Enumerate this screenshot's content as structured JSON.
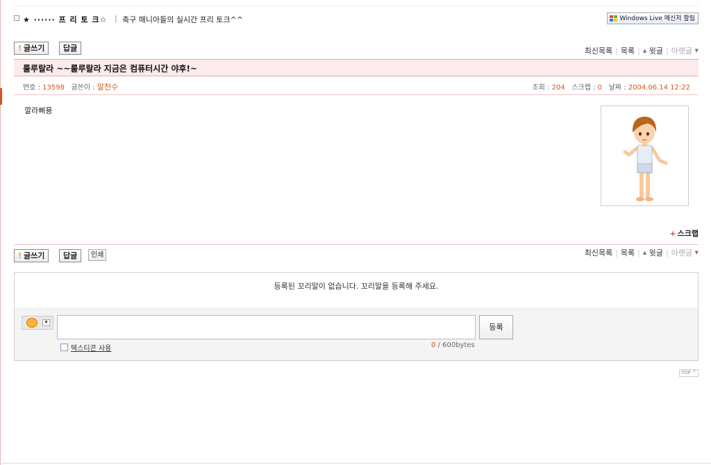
{
  "header": {
    "cafe_title": "★ ······ 프 리 토 크☆",
    "separator": "|",
    "cafe_desc": "축구 매니아들의 실시간 프리 토크^^",
    "windows_live_label": "Windows Live 메신저 할림"
  },
  "toolbar": {
    "write_label": "글쓰기",
    "reply_label": "답글",
    "print_label": "인쇄"
  },
  "nav": {
    "latest_label": "최신목록",
    "list_label": "목록",
    "prev_label": "윗글",
    "next_label": "아랫글"
  },
  "post": {
    "subject": "룰루랄라 ~~룰루랄라 지금은 컴퓨터시간 야후!~",
    "number_label": "번호 :",
    "number": "13598",
    "author_label": "글쓴이 :",
    "author": "말천수",
    "views_label": "조회 :",
    "views": "204",
    "scrap_label": "스크랩 :",
    "scrap_count": "0",
    "date_label": "날짜 :",
    "date": "2004.06.14 12:22",
    "body": "깔라삐용"
  },
  "scrap_button_label": "스크랩",
  "comments": {
    "empty_message": "등록된 꼬리말이 없습니다. 꼬리말을 등록해 주세요.",
    "submit_label": "등록",
    "textcon_label": "텍스티콘 사용",
    "char_count": "0",
    "char_limit": "/ 600bytes"
  },
  "top_label": "TOP",
  "colors": {
    "accent": "#d9531e",
    "subject_bg": "#fdeaea",
    "subject_border": "#eba9a9"
  }
}
